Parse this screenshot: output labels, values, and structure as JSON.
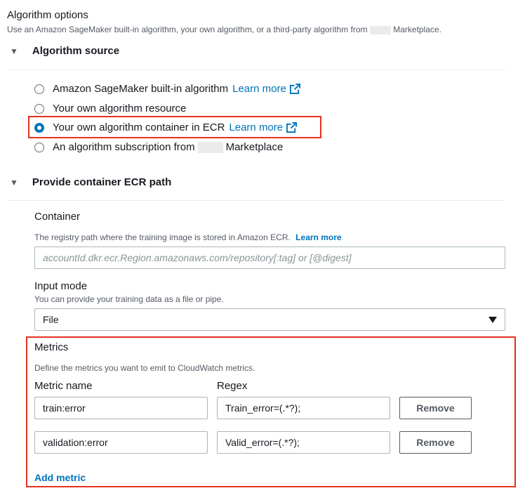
{
  "algorithm_options": {
    "title": "Algorithm options",
    "description_prefix": "Use an Amazon SageMaker built-in algorithm, your own algorithm, or a third-party algorithm from",
    "description_suffix": "Marketplace."
  },
  "algorithm_source": {
    "heading": "Algorithm source",
    "options": [
      {
        "label": "Amazon SageMaker built-in algorithm",
        "link": "Learn more",
        "checked": false
      },
      {
        "label": "Your own algorithm resource",
        "checked": false
      },
      {
        "label": "Your own algorithm container in ECR",
        "link": "Learn more",
        "checked": true
      },
      {
        "label_prefix": "An algorithm subscription from",
        "label_suffix": "Marketplace",
        "checked": false
      }
    ]
  },
  "container_section": {
    "heading": "Provide container ECR path",
    "container_label": "Container",
    "container_desc": "The registry path where the training image is stored in Amazon ECR.",
    "container_link": "Learn more",
    "container_placeholder": "accountId.dkr.ecr.Region.amazonaws.com/repository[:tag] or [@digest]",
    "input_mode_label": "Input mode",
    "input_mode_desc": "You can provide your training data as a file or pipe.",
    "input_mode_value": "File"
  },
  "metrics": {
    "heading": "Metrics",
    "description": "Define the metrics you want to emit to CloudWatch metrics.",
    "col_name": "Metric name",
    "col_regex": "Regex",
    "rows": [
      {
        "name": "train:error",
        "regex": "Train_error=(.*?);",
        "remove": "Remove"
      },
      {
        "name": "validation:error",
        "regex": "Valid_error=(.*?);",
        "remove": "Remove"
      }
    ],
    "add_label": "Add metric"
  },
  "colors": {
    "accent": "#0073bb",
    "highlight": "#e5321f"
  },
  "icons": [
    "triangle-down-icon",
    "external-link-icon",
    "select-caret-icon"
  ]
}
